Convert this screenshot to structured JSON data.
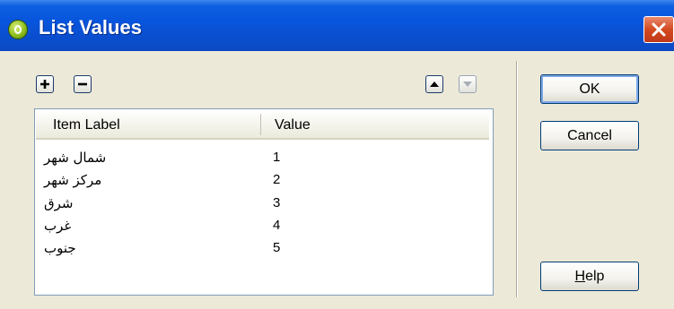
{
  "window": {
    "title": "List Values",
    "app_icon": "dreamweaver-icon",
    "close_icon": "close-icon"
  },
  "toolbar": {
    "add_icon": "plus-icon",
    "remove_icon": "minus-icon",
    "move_up_icon": "arrow-up-icon",
    "move_down_icon": "arrow-down-icon"
  },
  "list": {
    "columns": [
      "Item Label",
      "Value"
    ],
    "rows": [
      {
        "label": "شمال شهر",
        "value": "1"
      },
      {
        "label": "مركز شهر",
        "value": "2"
      },
      {
        "label": "شرق",
        "value": "3"
      },
      {
        "label": "غرب",
        "value": "4"
      },
      {
        "label": "جنوب",
        "value": "5"
      }
    ]
  },
  "buttons": {
    "ok": "OK",
    "cancel": "Cancel",
    "help": "Help"
  },
  "colors": {
    "titlebar": "#0855dd",
    "dialog_bg": "#ece9d8",
    "close_button": "#d44a20"
  }
}
